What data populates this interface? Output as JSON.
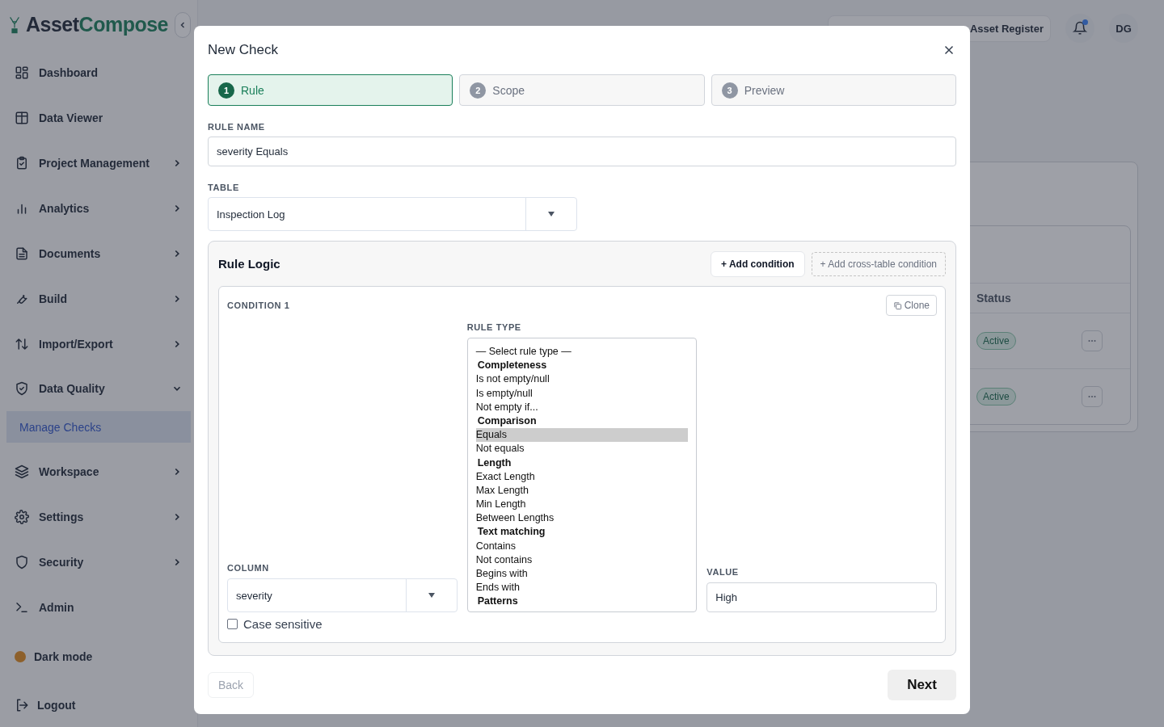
{
  "sidebar": {
    "logo": {
      "part_1": "Asset",
      "part_2": "Compose"
    },
    "items": [
      {
        "label": "Dashboard",
        "kind": "link"
      },
      {
        "label": "Data Viewer",
        "kind": "link"
      },
      {
        "label": "Project Management",
        "kind": "group",
        "expanded": false
      },
      {
        "label": "Analytics",
        "kind": "group",
        "expanded": false
      },
      {
        "label": "Documents",
        "kind": "group",
        "expanded": false
      },
      {
        "label": "Build",
        "kind": "group",
        "expanded": false
      },
      {
        "label": "Import/Export",
        "kind": "group",
        "expanded": false
      },
      {
        "label": "Data Quality",
        "kind": "group",
        "expanded": true,
        "children": [
          {
            "label": "Manage Checks",
            "selected": true
          }
        ]
      },
      {
        "label": "Workspace",
        "kind": "group",
        "expanded": false
      },
      {
        "label": "Settings",
        "kind": "group",
        "expanded": false
      },
      {
        "label": "Security",
        "kind": "group",
        "expanded": false
      },
      {
        "label": "Admin",
        "kind": "link"
      }
    ],
    "dark_mode": "Dark mode",
    "logout": "Logout"
  },
  "header": {
    "register": "Asset Register",
    "avatar": "DG",
    "notification_unread": true
  },
  "background_table": {
    "columns": [
      "Status"
    ],
    "rows": [
      {
        "status": "Active"
      },
      {
        "status": "Active"
      }
    ]
  },
  "modal": {
    "title": "New Check",
    "steps": [
      {
        "number": "1",
        "label": "Rule",
        "selected": true
      },
      {
        "number": "2",
        "label": "Scope",
        "selected": false
      },
      {
        "number": "3",
        "label": "Preview",
        "selected": false
      }
    ],
    "rule_name": {
      "label": "RULE NAME",
      "value": "severity Equals"
    },
    "table": {
      "label": "TABLE",
      "value": "Inspection Log"
    },
    "rule_logic": {
      "title": "Rule Logic",
      "add_condition": "+ Add condition",
      "add_cross_table": "+ Add cross-table condition",
      "conditions": [
        {
          "title": "CONDITION 1",
          "clone": "Clone",
          "column": {
            "label": "COLUMN",
            "value": "severity"
          },
          "rule_type": {
            "label": "RULE TYPE",
            "options": [
              {
                "label": "— Select rule type —",
                "kind": "placeholder",
                "selected": false
              },
              {
                "label": "Completeness",
                "kind": "group",
                "selected": false
              },
              {
                "label": "Is not empty/null",
                "kind": "option",
                "selected": false
              },
              {
                "label": "Is empty/null",
                "kind": "option",
                "selected": false
              },
              {
                "label": "Not empty if...",
                "kind": "option",
                "selected": false
              },
              {
                "label": "Comparison",
                "kind": "group",
                "selected": false
              },
              {
                "label": "Equals",
                "kind": "option",
                "selected": true
              },
              {
                "label": "Not equals",
                "kind": "option",
                "selected": false
              },
              {
                "label": "Length",
                "kind": "group",
                "selected": false
              },
              {
                "label": "Exact Length",
                "kind": "option",
                "selected": false
              },
              {
                "label": "Max Length",
                "kind": "option",
                "selected": false
              },
              {
                "label": "Min Length",
                "kind": "option",
                "selected": false
              },
              {
                "label": "Between Lengths",
                "kind": "option",
                "selected": false
              },
              {
                "label": "Text matching",
                "kind": "group",
                "selected": false
              },
              {
                "label": "Contains",
                "kind": "option",
                "selected": false
              },
              {
                "label": "Not contains",
                "kind": "option",
                "selected": false
              },
              {
                "label": "Begins with",
                "kind": "option",
                "selected": false
              },
              {
                "label": "Ends with",
                "kind": "option",
                "selected": false
              },
              {
                "label": "Patterns",
                "kind": "group",
                "selected": false
              }
            ]
          },
          "value": {
            "label": "VALUE",
            "value": "High"
          },
          "case_sensitive": {
            "label": "Case sensitive",
            "checked": false
          }
        }
      ]
    },
    "back": {
      "label": "Back",
      "disabled": true
    },
    "next": {
      "label": "Next",
      "disabled": false
    }
  }
}
